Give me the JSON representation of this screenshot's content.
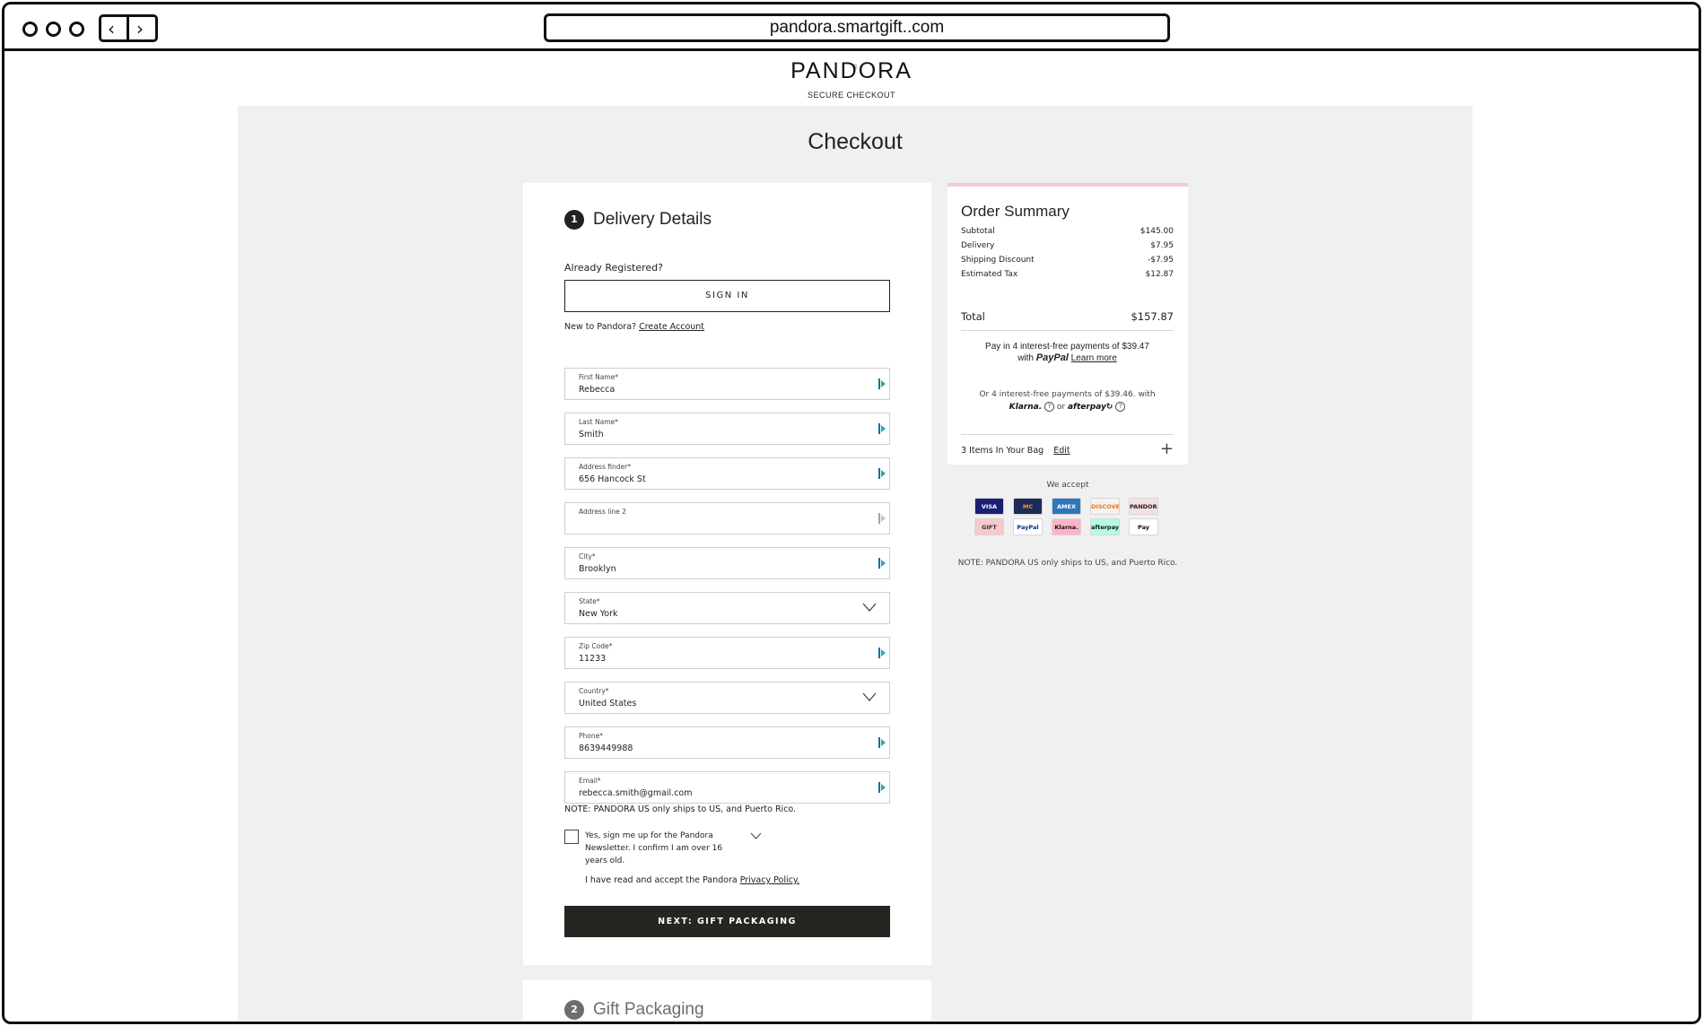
{
  "browser": {
    "url": "pandora.smartgift..com"
  },
  "header": {
    "logo": "PANDORA",
    "subtitle": "SECURE CHECKOUT"
  },
  "page": {
    "title": "Checkout"
  },
  "delivery": {
    "step_number": "1",
    "title": "Delivery Details",
    "already_registered": "Already Registered?",
    "sign_in_label": "SIGN IN",
    "new_to_text": "New to Pandora?",
    "create_account_label": "Create Account",
    "fields": [
      {
        "label": "First Name*",
        "value": "Rebecca"
      },
      {
        "label": "Last Name*",
        "value": "Smith"
      },
      {
        "label": "Address finder*",
        "value": "656 Hancock St"
      },
      {
        "label": "Address line 2",
        "value": ""
      },
      {
        "label": "City*",
        "value": "Brooklyn"
      },
      {
        "label": "State*",
        "value": "New York"
      },
      {
        "label": "Zip Code*",
        "value": "11233"
      },
      {
        "label": "Country*",
        "value": "United States"
      },
      {
        "label": "Phone*",
        "value": "8639449988"
      },
      {
        "label": "Email*",
        "value": "rebecca.smith@gmail.com"
      }
    ],
    "ship_note": "NOTE: PANDORA US only ships to US, and Puerto Rico.",
    "newsletter_text": "Yes, sign me up for the Pandora Newsletter. I confirm I am over 16 years old.",
    "newsletter_checked": false,
    "privacy_text": "I have read and accept the Pandora",
    "privacy_link": "Privacy Policy.",
    "next_label": "NEXT: GIFT PACKAGING"
  },
  "gift": {
    "step_number": "2",
    "title": "Gift Packaging"
  },
  "summary": {
    "title": "Order Summary",
    "rows": [
      {
        "label": "Subtotal",
        "value": "$145.00"
      },
      {
        "label": "Delivery",
        "value": "$7.95"
      },
      {
        "label": "Shipping Discount",
        "value": "-$7.95"
      },
      {
        "label": "Estimated Tax",
        "value": "$12.87"
      }
    ],
    "total_label": "Total",
    "total_value": "$157.87",
    "paypal_line1": "Pay in 4 interest-free payments of $39.47",
    "paypal_with": "with",
    "paypal_brand": "PayPal",
    "paypal_learn": "Learn more",
    "klarna_line": "Or 4 interest-free payments of $39.46. with",
    "klarna_brand": "Klarna.",
    "or_text": "or",
    "afterpay_brand": "afterpay",
    "bag_text": "3 Items In Your Bag",
    "bag_edit": "Edit"
  },
  "accept": {
    "title": "We accept",
    "methods": [
      {
        "name": "VISA",
        "bg": "#1a1f71",
        "fg": "#ffffff"
      },
      {
        "name": "MC",
        "bg": "#1d2a5a",
        "fg": "#f79e1b"
      },
      {
        "name": "AMEX",
        "bg": "#2e77bb",
        "fg": "#ffffff"
      },
      {
        "name": "DISCOVER",
        "bg": "#f3f3f3",
        "fg": "#e8731a"
      },
      {
        "name": "PANDORA",
        "bg": "#f6dfe3",
        "fg": "#222222"
      },
      {
        "name": "GIFT",
        "bg": "#f6c9cf",
        "fg": "#333333"
      },
      {
        "name": "PayPal",
        "bg": "#ffffff",
        "fg": "#003087"
      },
      {
        "name": "Klarna.",
        "bg": "#ffb3c7",
        "fg": "#111111"
      },
      {
        "name": "afterpay",
        "bg": "#b2fce4",
        "fg": "#111111"
      },
      {
        "name": "Pay",
        "bg": "#ffffff",
        "fg": "#111111"
      }
    ],
    "note": "NOTE: PANDORA US only ships to US, and Puerto Rico."
  }
}
